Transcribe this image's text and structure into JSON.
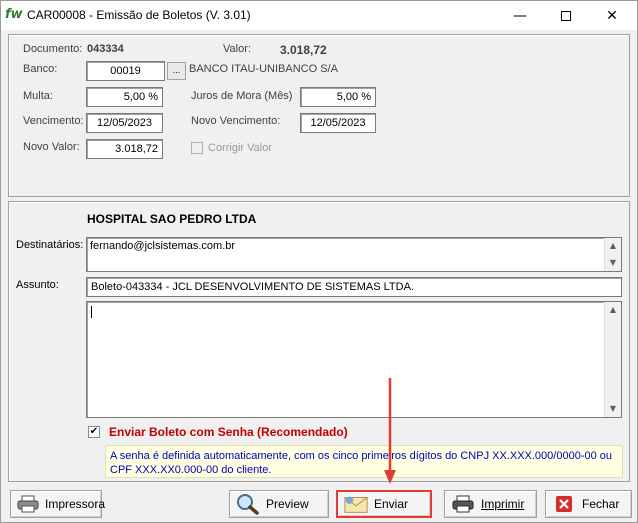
{
  "window": {
    "app_icon_text": "fw",
    "title": "CAR00008 - Emissão de Boletos (V. 3.01)",
    "controls": {
      "minimize": "—",
      "close": "✕"
    }
  },
  "details": {
    "documento_label": "Documento:",
    "documento_value": "043334",
    "valor_label": "Valor:",
    "valor_value": "3.018,72",
    "banco_label": "Banco:",
    "banco_code": "00019",
    "banco_lookup": "...",
    "banco_name": "BANCO ITAU-UNIBANCO S/A",
    "multa_label": "Multa:",
    "multa_value": "5,00 %",
    "juros_label": "Juros de Mora (Mês)",
    "juros_value": "5,00 %",
    "vencimento_label": "Vencimento:",
    "vencimento_value": "12/05/2023",
    "novo_vencimento_label": "Novo Vencimento:",
    "novo_vencimento_value": "12/05/2023",
    "novo_valor_label": "Novo Valor:",
    "novo_valor_value": "3.018,72",
    "corrigir_valor_label": "Corrigir Valor"
  },
  "email": {
    "recipient_name": "HOSPITAL SAO PEDRO LTDA",
    "destinatarios_label": "Destinatários:",
    "destinatarios_value": "fernando@jclsistemas.com.br",
    "assunto_label": "Assunto:",
    "assunto_value": "Boleto-043334 - JCL DESENVOLVIMENTO DE SISTEMAS LTDA.",
    "body_value": "",
    "enviar_com_senha_checked": true,
    "enviar_com_senha_label": "Enviar Boleto com Senha (Recomendado)",
    "info_line1": "A senha é definida automaticamente, com os cinco primeiros dígitos do CNPJ XX.XXX.000/0000-00 ou",
    "info_line2": "CPF XXX.XX0.000-00 do cliente."
  },
  "buttons": {
    "impressora": "Impressora",
    "preview": "Preview",
    "enviar": "Enviar",
    "imprimir": "Imprimir",
    "fechar": "Fechar"
  },
  "colors": {
    "annotation_red": "#e53935",
    "warning_text": "#c00000",
    "info_text": "#0000c0",
    "info_bg": "#ffffe1"
  }
}
